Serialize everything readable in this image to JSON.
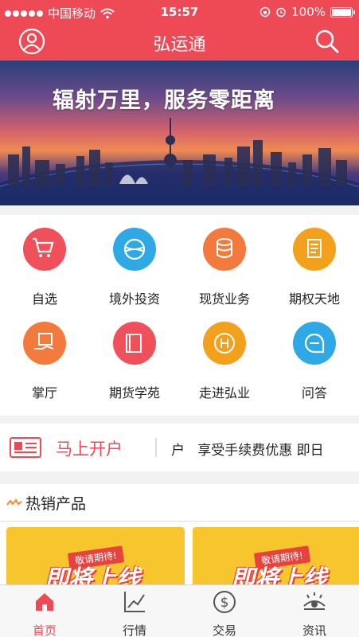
{
  "status_bar": {
    "carrier": "中国移动",
    "time": "15:57",
    "battery": "100%",
    "battery_level": 1.0
  },
  "nav": {
    "title": "弘运通",
    "left_icon": "user-icon",
    "right_icon": "search-icon"
  },
  "banner": {
    "slogan": "辐射万里，服务零距离"
  },
  "grid": [
    {
      "label": "自选",
      "icon": "cart-icon",
      "color": "#f0505a"
    },
    {
      "label": "境外投资",
      "icon": "globe-icon",
      "color": "#2ea9e6"
    },
    {
      "label": "现货业务",
      "icon": "coins-icon",
      "color": "#f27a3c"
    },
    {
      "label": "期权天地",
      "icon": "scroll-icon",
      "color": "#f3a01d"
    },
    {
      "label": "掌厅",
      "icon": "hand-card-icon",
      "color": "#f27a3c"
    },
    {
      "label": "期货学苑",
      "icon": "book-icon",
      "color": "#f0505a"
    },
    {
      "label": "走进弘业",
      "icon": "h-logo-icon",
      "color": "#f3a01d"
    },
    {
      "label": "问答",
      "icon": "chat-icon",
      "color": "#2ea9e6"
    }
  ],
  "open_account": {
    "label": "马上开户",
    "promo": "户   享受手续费优惠 即日"
  },
  "hot_products": {
    "title": "热销产品",
    "cards": [
      {
        "tag": "敬请期待!",
        "headline": "即将上线"
      },
      {
        "tag": "敬请期待!",
        "headline": "即将上线"
      }
    ]
  },
  "tabbar": [
    {
      "label": "首页",
      "icon": "home-icon",
      "active": true
    },
    {
      "label": "行情",
      "icon": "chart-icon",
      "active": false
    },
    {
      "label": "交易",
      "icon": "dollar-icon",
      "active": false
    },
    {
      "label": "资讯",
      "icon": "news-eye-icon",
      "active": false
    }
  ],
  "colors": {
    "brand_red": "#ee4a56",
    "tab_active": "#ee4a56"
  }
}
